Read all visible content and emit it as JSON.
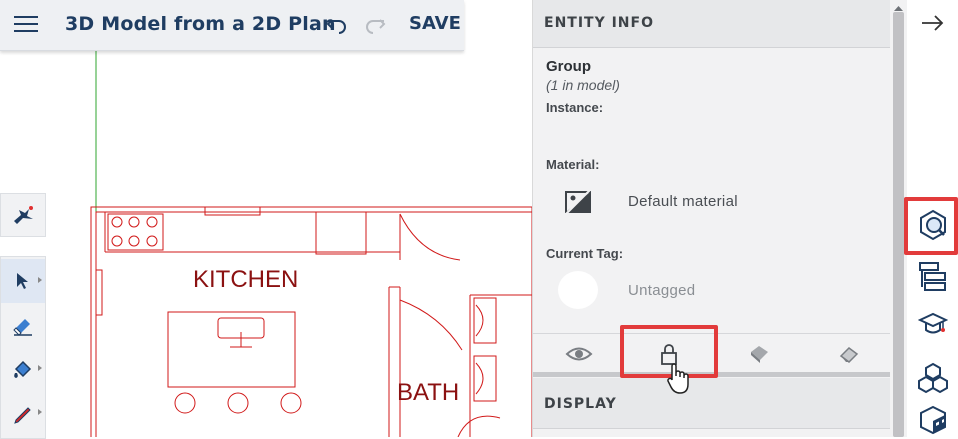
{
  "header": {
    "menu_icon": "hamburger-icon",
    "title": "3D Model from a 2D Plan",
    "undo_icon": "undo-icon",
    "redo_icon": "redo-icon",
    "save_label": "SAVE"
  },
  "plan": {
    "kitchen_label": "KITCHEN",
    "bath_label": "BATH"
  },
  "entity_info": {
    "title": "ENTITY INFO",
    "entity_type": "Group",
    "count": "(1 in model)",
    "instance_label": "Instance:",
    "material_label": "Material:",
    "material_value": "Default material",
    "tag_label": "Current Tag:",
    "tag_value": "Untagged",
    "tabs": [
      {
        "icon": "eye-icon"
      },
      {
        "icon": "lock-icon"
      },
      {
        "icon": "paint-bucket-icon"
      },
      {
        "icon": "eraser-icon"
      }
    ],
    "display_title": "DISPLAY"
  },
  "colors": {
    "highlight": "#e23b3b",
    "plan_red": "#d11a1a",
    "title_blue": "#1f3d62",
    "axis_green": "#2fa52f"
  }
}
